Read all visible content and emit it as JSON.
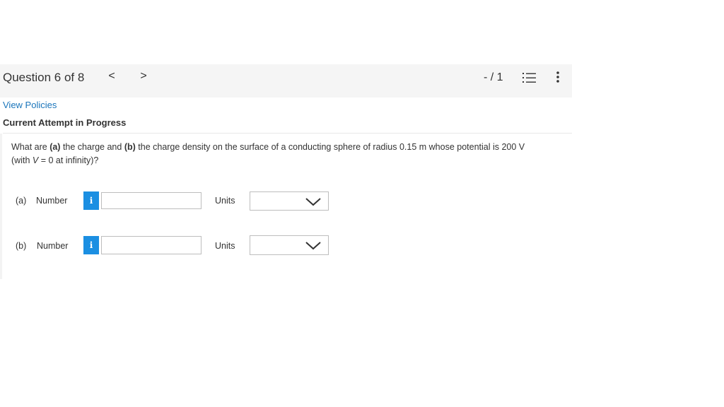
{
  "header": {
    "question_title": "Question 6 of 8",
    "prev_glyph": "<",
    "next_glyph": ">",
    "score": "- / 1",
    "list_icon": "list-icon",
    "more_icon": "more-vertical-icon"
  },
  "links": {
    "view_policies": "View Policies"
  },
  "attempt_status": "Current Attempt in Progress",
  "question": {
    "line1_part1": "What are ",
    "part_a_label": "(a)",
    "line1_part2": " the charge and ",
    "part_b_label": "(b)",
    "line1_part3": " the charge density on the surface of a conducting sphere of radius 0.15 m whose potential is 200 V",
    "line2_part1": "(with ",
    "line2_var": "V",
    "line2_part2": " = 0 at infinity)?"
  },
  "answers": [
    {
      "part": "(a)",
      "number_label": "Number",
      "info_glyph": "i",
      "value": "",
      "units_label": "Units",
      "units_selected": ""
    },
    {
      "part": "(b)",
      "number_label": "Number",
      "info_glyph": "i",
      "value": "",
      "units_label": "Units",
      "units_selected": ""
    }
  ],
  "colors": {
    "link": "#1a75bb",
    "info_button": "#1b8fe2",
    "topbar_bg": "#f5f5f5"
  }
}
